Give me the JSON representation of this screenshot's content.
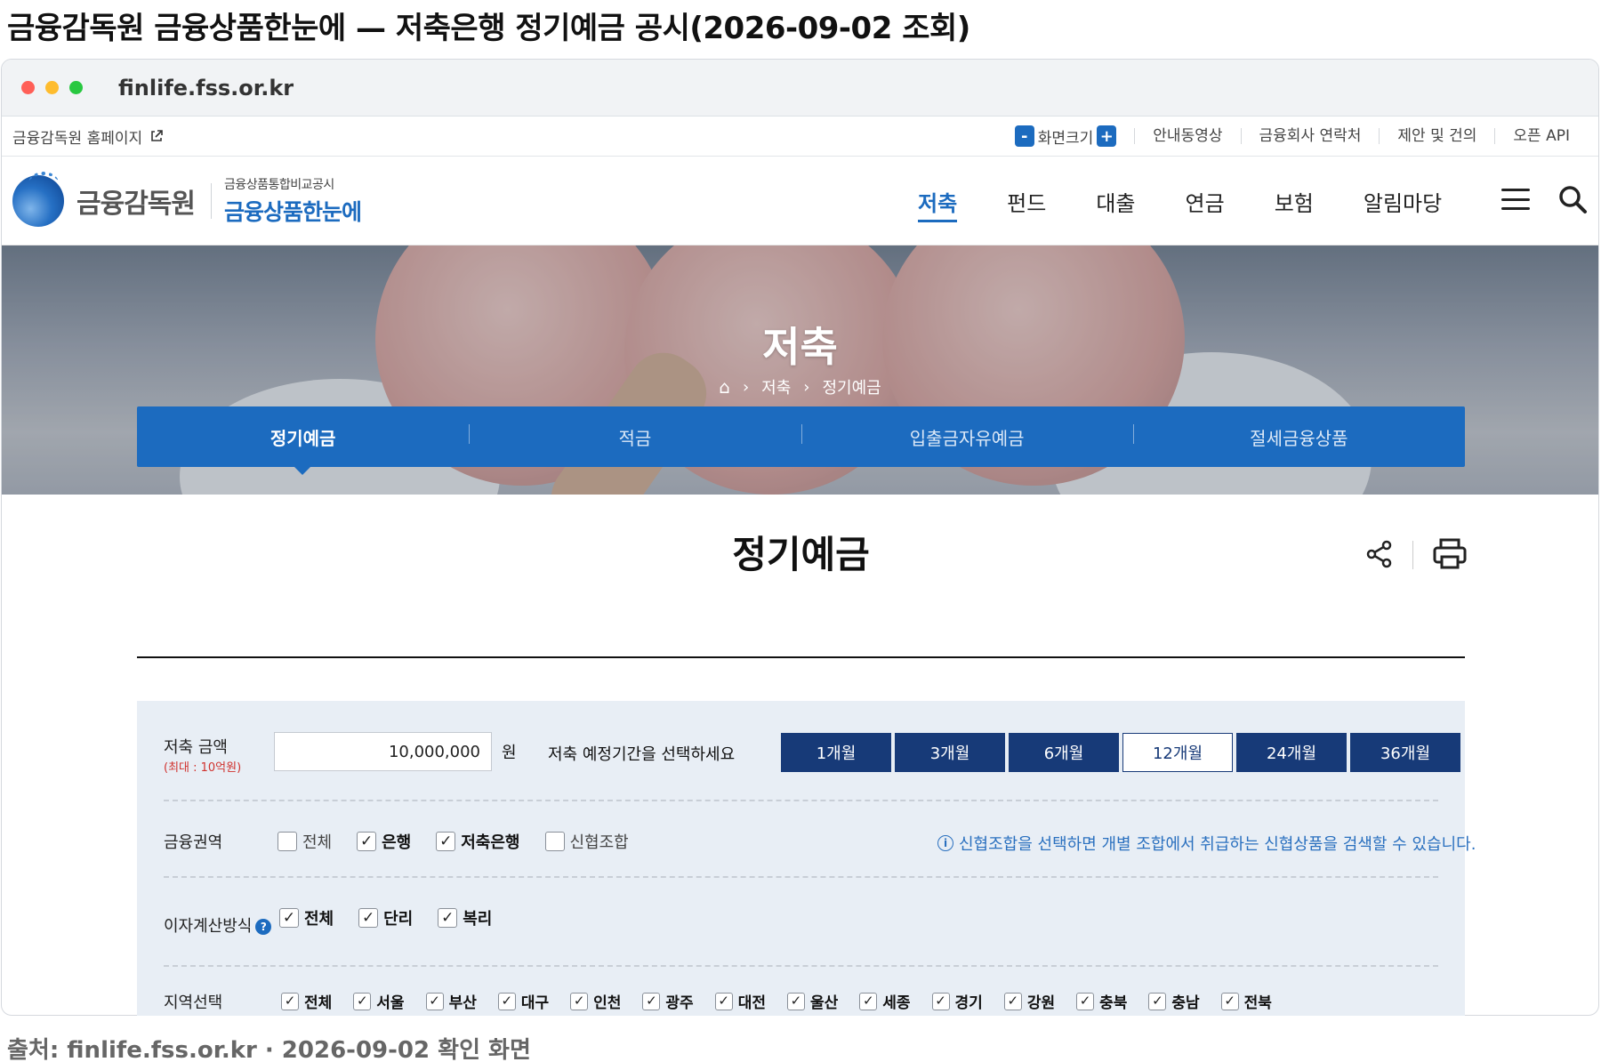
{
  "caption": {
    "title": "금융감독원 금융상품한눈에 — 저축은행 정기예금 공시(2026-09-02 조회)",
    "source": "출처: finlife.fss.or.kr · 2026-09-02 확인 화면"
  },
  "browser": {
    "url": "finlife.fss.or.kr"
  },
  "utility": {
    "home_link": "금융감독원 홈페이지",
    "zoom_minus": "-",
    "zoom_label": "화면크기",
    "zoom_plus": "+",
    "links": [
      "안내동영상",
      "금융회사 연락처",
      "제안 및 건의",
      "오픈 API"
    ]
  },
  "header": {
    "logo_name": "금융감독원",
    "logo_small": "금융상품통합비교공시",
    "logo_big": "금융상품한눈에",
    "nav": [
      "저축",
      "펀드",
      "대출",
      "연금",
      "보험",
      "알림마당"
    ],
    "active_nav": "저축"
  },
  "hero": {
    "title": "저축",
    "breadcrumb": [
      "저축",
      "정기예금"
    ]
  },
  "tabs": [
    {
      "label": "정기예금",
      "active": true
    },
    {
      "label": "적금",
      "active": false
    },
    {
      "label": "입출금자유예금",
      "active": false
    },
    {
      "label": "절세금융상품",
      "active": false
    }
  ],
  "main": {
    "title": "정기예금"
  },
  "filters": {
    "amount_label": "저축 금액",
    "amount_note": "(최대 : 10억원)",
    "amount_value": "10,000,000",
    "amount_unit": "원",
    "period_label": "저축 예정기간을 선택하세요",
    "periods": [
      {
        "label": "1개월",
        "selected": false
      },
      {
        "label": "3개월",
        "selected": false
      },
      {
        "label": "6개월",
        "selected": false
      },
      {
        "label": "12개월",
        "selected": true
      },
      {
        "label": "24개월",
        "selected": false
      },
      {
        "label": "36개월",
        "selected": false
      }
    ],
    "sector_label": "금융권역",
    "sectors": [
      {
        "label": "전체",
        "checked": false
      },
      {
        "label": "은행",
        "checked": true
      },
      {
        "label": "저축은행",
        "checked": true
      },
      {
        "label": "신협조합",
        "checked": false
      }
    ],
    "sector_notice": "신협조합을 선택하면 개별 조합에서 취급하는 신협상품을 검색할 수 있습니다.",
    "interest_label": "이자계산방식",
    "interest_types": [
      {
        "label": "전체",
        "checked": true
      },
      {
        "label": "단리",
        "checked": true
      },
      {
        "label": "복리",
        "checked": true
      }
    ],
    "region_label": "지역선택",
    "regions": [
      {
        "label": "전체",
        "checked": true
      },
      {
        "label": "서울",
        "checked": true
      },
      {
        "label": "부산",
        "checked": true
      },
      {
        "label": "대구",
        "checked": true
      },
      {
        "label": "인천",
        "checked": true
      },
      {
        "label": "광주",
        "checked": true
      },
      {
        "label": "대전",
        "checked": true
      },
      {
        "label": "울산",
        "checked": true
      },
      {
        "label": "세종",
        "checked": true
      },
      {
        "label": "경기",
        "checked": true
      },
      {
        "label": "강원",
        "checked": true
      },
      {
        "label": "충북",
        "checked": true
      },
      {
        "label": "충남",
        "checked": true
      },
      {
        "label": "전북",
        "checked": true
      }
    ]
  }
}
